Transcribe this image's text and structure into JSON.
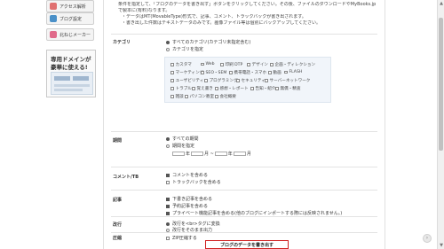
{
  "sidebar": {
    "items": [
      {
        "label": "アクセス解析",
        "color": "#e07070"
      },
      {
        "label": "ブログ設定",
        "color": "#4a90c8"
      },
      {
        "label": "北ねじメーカー",
        "color": "#e06a8a"
      }
    ],
    "banner": {
      "line1": "専用ドメインが",
      "line2": "豪華に使える!"
    }
  },
  "intro": {
    "line1": "条件を指定して、「ブログのデータを書き出す」ボタンをクリックしてください。その後、ファイルのダウンロードやMyBooks.jp",
    "line2": "で製本に(有料)なります。",
    "bullet1": "・データはMT(MovableType)形式で、記事、コメント、トラックバックが書き出されます。",
    "bullet2": "・書き出した件数はテキストデータのみです。画像ファイル等は個別にバックアップしてください。"
  },
  "category": {
    "label": "カテゴリ",
    "all": "すべてのカテゴリ(カテゴリ未指定含む)",
    "specify": "カテゴリを指定",
    "items": [
      "カスタマ",
      "Web",
      "印刷 DTP",
      "デザイン",
      "企画・ディレクション",
      "マーケティング",
      "SEO・SEM",
      "携帯電話・スマホ",
      "動画",
      "FLASH",
      "ユーザビリティ",
      "プログラミング",
      "セキュリティ",
      "サーバーネットワーク",
      "トラブル",
      "覚え書き",
      "感想・レポート",
      "告知・紹介",
      "無償・精査",
      "雑談",
      "パソコン教室",
      "会社概要"
    ]
  },
  "period": {
    "label": "期間",
    "all": "すべての期間",
    "specify": "期間を指定",
    "year1": "年",
    "month1": "月 ~",
    "year2": "年",
    "month2": "月"
  },
  "comment": {
    "label": "コメント/TB",
    "include_comment": "コメントを含める",
    "include_tb": "トラックバックを含める"
  },
  "article": {
    "label": "記事",
    "draft": "下書き記事を含める",
    "scheduled": "予約記事を含める",
    "private": "プライベート機能記事を含める(他のブログにインポートする際には反映されません。)"
  },
  "linebreak": {
    "label": "改行",
    "convert": "改行を<br>タグに変換",
    "keep": "改行をそのまま出力"
  },
  "compress": {
    "label": "圧縮",
    "zip": "ZIP圧縮する"
  },
  "submit_label": "ブログのデータを書き出す",
  "colors": {
    "accent_red": "#d02020",
    "panel_blue": "#f1f5fa"
  }
}
